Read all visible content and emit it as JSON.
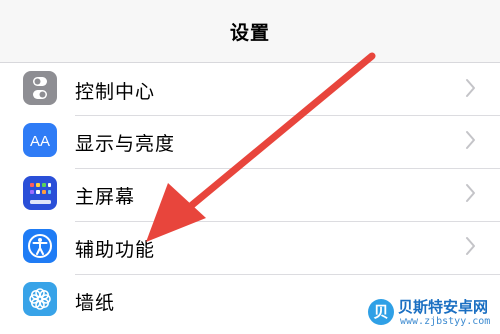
{
  "nav": {
    "title": "设置"
  },
  "settings_rows": [
    {
      "label": "控制中心",
      "icon": "control-center-icon",
      "color": "#8e8e93"
    },
    {
      "label": "显示与亮度",
      "icon": "display-brightness-icon",
      "icon_text": "AA",
      "color": "#2f7cf6"
    },
    {
      "label": "主屏幕",
      "icon": "home-screen-icon",
      "color": "#2a4fd8"
    },
    {
      "label": "辅助功能",
      "icon": "accessibility-icon",
      "color": "#1f7cf5"
    },
    {
      "label": "墙纸",
      "icon": "wallpaper-icon",
      "color": "#38a3e8"
    }
  ],
  "annotation": {
    "icon": "red-arrow-icon",
    "color": "#e8453c",
    "points_to": "辅助功能"
  },
  "watermark": {
    "title": "贝斯特安卓网",
    "url": "www.zjbstyy.com",
    "logo_glyph": "贝"
  }
}
